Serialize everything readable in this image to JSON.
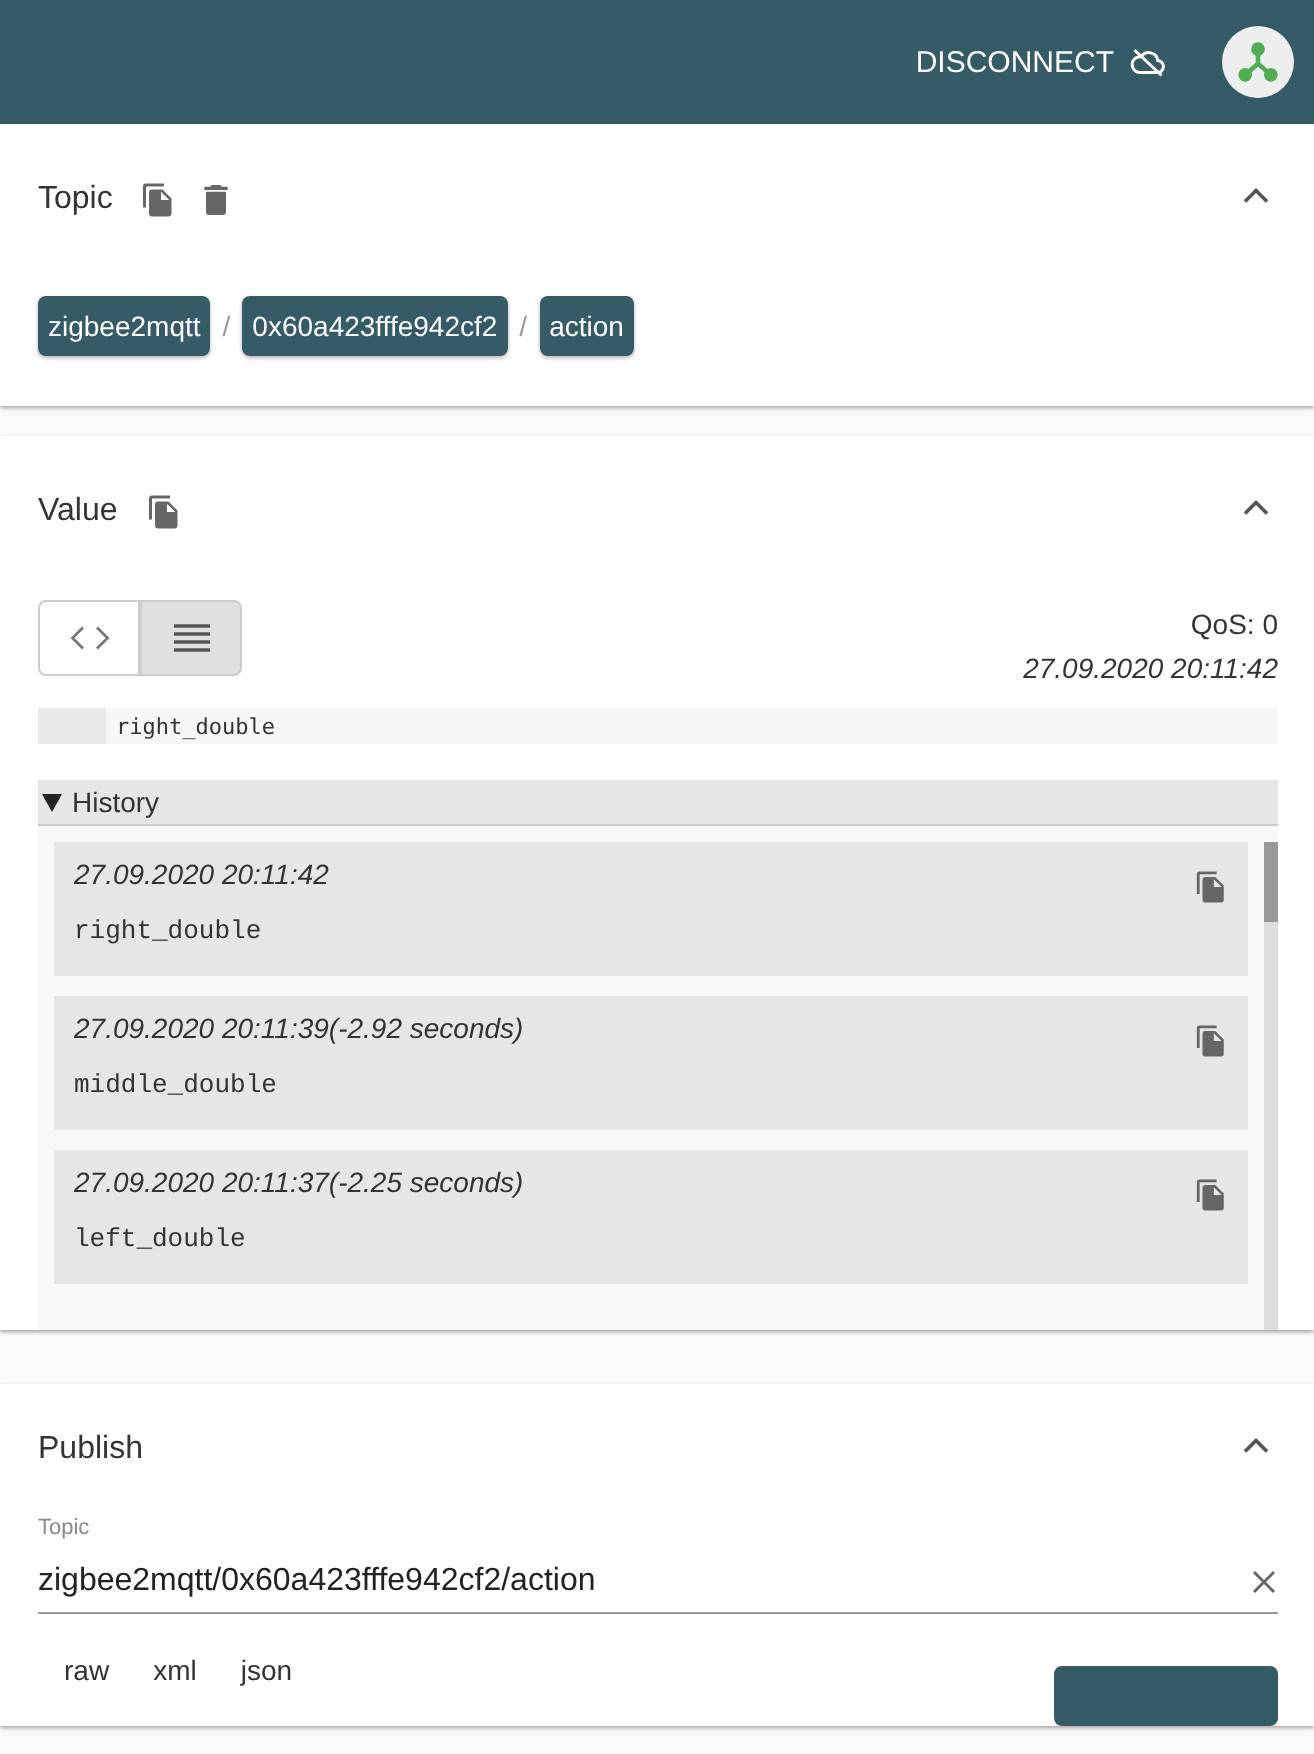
{
  "header": {
    "disconnect_label": "DISCONNECT"
  },
  "topic": {
    "title": "Topic",
    "expanded": true,
    "segments": [
      "zigbee2mqtt",
      "0x60a423fffe942cf2",
      "action"
    ],
    "separator": "/"
  },
  "value": {
    "title": "Value",
    "expanded": true,
    "view_modes": [
      {
        "kind": "code",
        "selected": false
      },
      {
        "kind": "text",
        "selected": true
      }
    ],
    "qos": "QoS: 0",
    "timestamp": "27.09.2020 20:11:42",
    "payload": "right_double",
    "history": {
      "label": "History",
      "expanded": true,
      "items": [
        {
          "time": "27.09.2020 20:11:42",
          "payload": "right_double"
        },
        {
          "time": "27.09.2020 20:11:39(-2.92 seconds)",
          "payload": "middle_double"
        },
        {
          "time": "27.09.2020 20:11:37(-2.25 seconds)",
          "payload": "left_double"
        }
      ]
    }
  },
  "publish": {
    "title": "Publish",
    "expanded": true,
    "topic_label": "Topic",
    "topic_value": "zigbee2mqtt/0x60a423fffe942cf2/action",
    "formats": [
      {
        "label": "raw"
      },
      {
        "label": "xml"
      },
      {
        "label": "json"
      }
    ]
  }
}
